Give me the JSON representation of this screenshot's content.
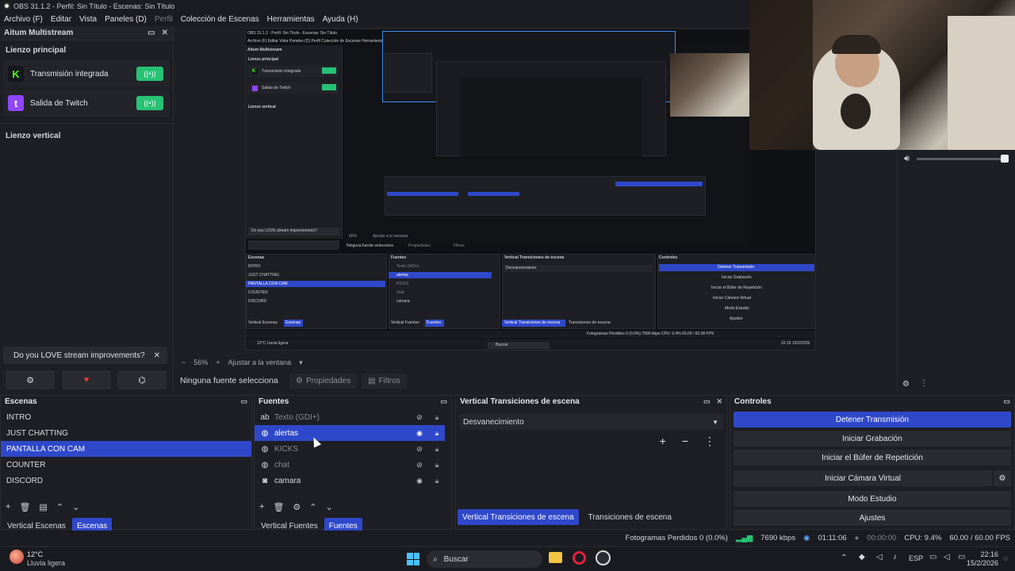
{
  "window": {
    "title": "OBS 31.1.2 - Perfil: Sin Título - Escenas: Sin Título"
  },
  "menu": [
    {
      "label": "Archivo (F)",
      "dim": false
    },
    {
      "label": "Editar",
      "dim": false
    },
    {
      "label": "Vista",
      "dim": false
    },
    {
      "label": "Paneles (D)",
      "dim": false
    },
    {
      "label": "Perfil",
      "dim": true
    },
    {
      "label": "Colección de Escenas",
      "dim": false
    },
    {
      "label": "Herramientas",
      "dim": false
    },
    {
      "label": "Ayuda (H)",
      "dim": false
    }
  ],
  "multistream": {
    "title": "Aitum Multistream",
    "main_canvas": "Lienzo principal",
    "outputs": [
      {
        "name": "Transmisión integrada",
        "logo": "K",
        "color": "#16171c",
        "logo_color": "#53fc18"
      },
      {
        "name": "Salida de Twitch",
        "logo": "t",
        "color": "#9146ff",
        "logo_color": "#ffffff"
      }
    ],
    "toggle_icon": "((•))",
    "vertical_canvas": "Lienzo vertical",
    "promo": "Do you LOVE stream improvements?"
  },
  "preview_mini": {
    "title": "OBS 31.1.2 - Perfil: Sin Título - Escenas: Sin Título",
    "menu": "Archivo (F)   Editar   Vista   Paneles (D)   Perfil   Colección de Escenas   Herramientas   Ayuda (H)",
    "multistream": "Aitum Multistream",
    "main_canvas": "Lienzo principal",
    "out1": "Transmisión integrada",
    "out2": "Salida de Twitch",
    "vertical": "Lienzo vertical",
    "promo": "Do you LOVE stream improvements?",
    "zoom": "56%",
    "fit": "Ajustar a la ventana",
    "no_source": "Ninguna fuente selecciona",
    "props": "Propiedades",
    "filters": "Filtros",
    "scenes_title": "Escenas",
    "sources_title": "Fuentes",
    "trans_title": "Vertical Transiciones de escena",
    "controls_title": "Controles",
    "scenes": [
      "INTRO",
      "JUST CHATTING",
      "PANTALLA CON CAM",
      "COUNTER",
      "DISCORD"
    ],
    "sources": [
      "Texto (GDI+)",
      "alertas",
      "KICKS",
      "chat",
      "camara"
    ],
    "fade": "Desvanecimiento",
    "controls": [
      "Detener Transmisión",
      "Iniciar Grabación",
      "Iniciar el Búfer de Repetición",
      "Iniciar Cámara Virtual",
      "Modo Estudio",
      "Ajustes"
    ],
    "tabs_scenes": [
      "Vertical Escenas",
      "Escenas"
    ],
    "tabs_sources": [
      "Vertical Fuentes",
      "Fuentes"
    ],
    "tabs_trans": [
      "Vertical Transiciones de escena",
      "Transiciones de escena"
    ],
    "status": "Fotogramas Perdidos 0 (0.0%)    7690 kbps    CPU: 9.4%    60.00 / 60.00 FPS",
    "weather": "12°C Lluvia ligera",
    "search": "Buscar",
    "clock": "22:16  15/2/2026"
  },
  "preview_bar": {
    "zoom": "56%",
    "fit": "Ajustar a la ventana"
  },
  "source_bar": {
    "no_source": "Ninguna fuente selecciona",
    "properties": "Propiedades",
    "filters": "Filtros"
  },
  "scenes": {
    "title": "Escenas",
    "items": [
      "INTRO",
      "JUST CHATTING",
      "PANTALLA CON CAM",
      "COUNTER",
      "DISCORD"
    ],
    "selected": 2,
    "tabs": [
      "Vertical Escenas",
      "Escenas"
    ],
    "active_tab": 1
  },
  "sources": {
    "title": "Fuentes",
    "items": [
      {
        "name": "Texto (GDI+)",
        "icon": "text-icon",
        "visible": false,
        "dim": true
      },
      {
        "name": "alertas",
        "icon": "browser-icon",
        "visible": true,
        "dim": false
      },
      {
        "name": "KICKS",
        "icon": "browser-icon",
        "visible": false,
        "dim": true
      },
      {
        "name": "chat",
        "icon": "browser-icon",
        "visible": false,
        "dim": true
      },
      {
        "name": "camara",
        "icon": "camera-icon",
        "visible": true,
        "dim": false
      }
    ],
    "selected": 1,
    "tabs": [
      "Vertical Fuentes",
      "Fuentes"
    ],
    "active_tab": 1
  },
  "transitions": {
    "title": "Vertical Transiciones de escena",
    "selected": "Desvanecimiento",
    "tabs": [
      "Vertical Transiciones de escena",
      "Transiciones de escena"
    ],
    "active_tab": 0
  },
  "controls": {
    "title": "Controles",
    "stop_stream": "Detener Transmisión",
    "record": "Iniciar Grabación",
    "replay": "Iniciar el Búfer de Repetición",
    "virtualcam": "Iniciar Cámara Virtual",
    "studio": "Modo Estudio",
    "settings": "Ajustes"
  },
  "status": {
    "dropped": "Fotogramas Perdidos 0 (0.0%)",
    "bitrate": "7690 kbps",
    "stream_time": "01:11:06",
    "rec_time": "00:00:00",
    "cpu": "CPU: 9.4%",
    "fps": "60.00 / 60.00 FPS"
  },
  "taskbar": {
    "temp": "12°C",
    "weather": "Lluvia ligera",
    "search": "Buscar",
    "lang": "ESP",
    "time": "22:16",
    "date": "15/2/2026"
  },
  "colors": {
    "accent": "#2f48c9",
    "toggle_on": "#27c274",
    "bg": "#1e1f24"
  }
}
